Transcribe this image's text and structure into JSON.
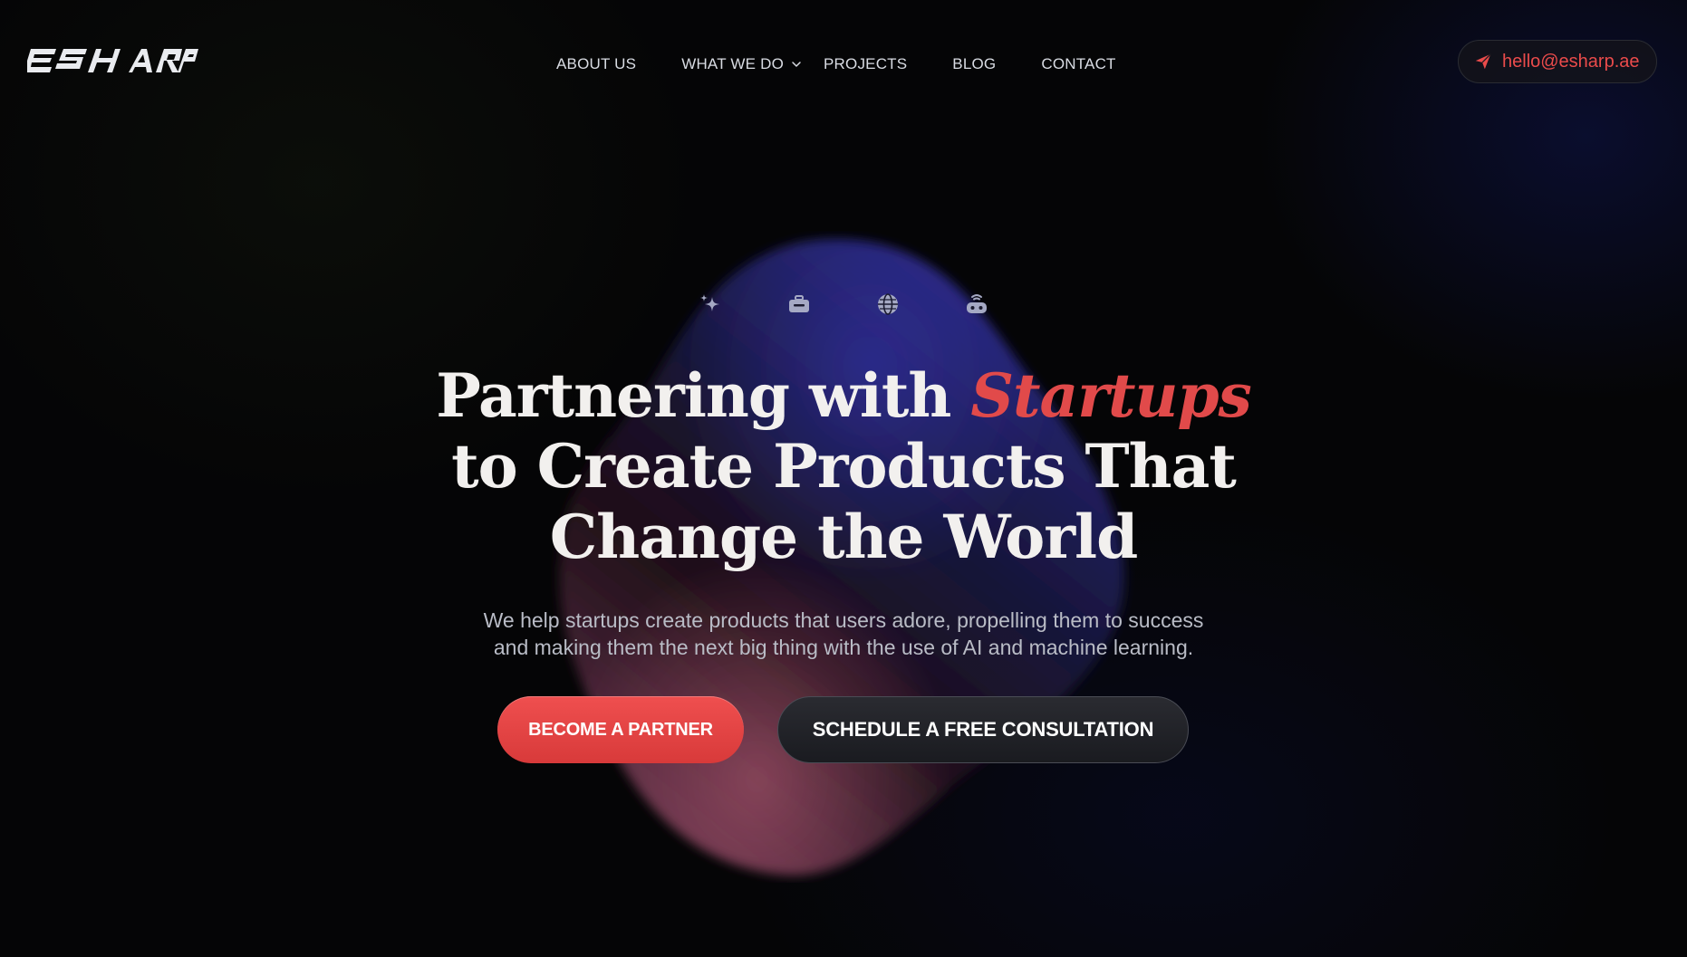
{
  "header": {
    "logo_text": "ESHARP",
    "nav": [
      {
        "label": "ABOUT US"
      },
      {
        "label": "WHAT WE DO",
        "has_dropdown": true
      },
      {
        "label": "PROJECTS"
      },
      {
        "label": "BLOG"
      },
      {
        "label": "CONTACT"
      }
    ],
    "email": "hello@esharp.ae"
  },
  "hero": {
    "icons": [
      "sparkle-icon",
      "toolbox-icon",
      "globe-icon",
      "robot-icon"
    ],
    "headline_part1": "Partnering with ",
    "headline_accent": "Startups",
    "headline_line2": "to Create Products That",
    "headline_line3": "Change the World",
    "subtext_line1": "We help startups create products that users adore, propelling them to success",
    "subtext_line2": "and making them the next big thing with the use of AI and machine learning.",
    "primary_button": "BECOME A PARTNER",
    "secondary_button": "SCHEDULE A FREE CONSULTATION"
  },
  "colors": {
    "accent": "#e14a4a",
    "background": "#050506",
    "text": "#f2f0ee",
    "muted_text": "#b9bcc6"
  }
}
